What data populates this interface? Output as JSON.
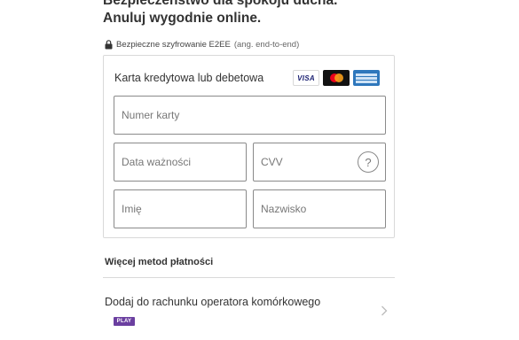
{
  "header": {
    "line1": "Bezpieczeństwo dla spokoju ducha.",
    "line2": "Anuluj wygodnie online."
  },
  "security_note": {
    "icon": "lock-icon",
    "text": "Bezpieczne szyfrowanie E2EE",
    "subtext": "(ang. end-to-end)"
  },
  "card_form": {
    "title": "Karta kredytowa lub debetowa",
    "logos": [
      {
        "name": "visa",
        "label": "VISA"
      },
      {
        "name": "mastercard"
      },
      {
        "name": "american-express"
      }
    ],
    "card_number": {
      "placeholder": "Numer karty",
      "value": ""
    },
    "expiry": {
      "placeholder": "Data ważności",
      "value": ""
    },
    "cvv": {
      "placeholder": "CVV",
      "value": "",
      "help_icon": "question-circle-icon",
      "help_label": "?"
    },
    "first_name": {
      "placeholder": "Imię",
      "value": ""
    },
    "last_name": {
      "placeholder": "Nazwisko",
      "value": ""
    }
  },
  "more_methods": {
    "title": "Więcej metod płatności",
    "items": [
      {
        "label": "Dodaj do rachunku operatora komórkowego",
        "logo": "PLAY",
        "icon": "chevron-right-icon"
      }
    ]
  }
}
